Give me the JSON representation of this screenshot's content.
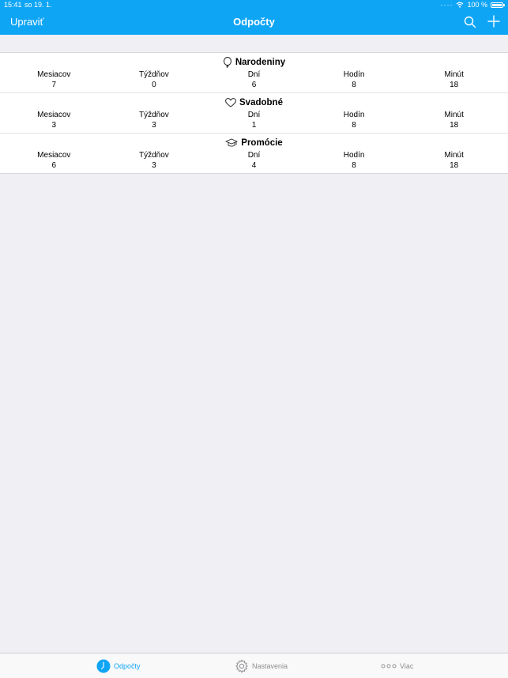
{
  "status_bar": {
    "time": "15:41",
    "date": "so 19. 1.",
    "battery": "100 %"
  },
  "nav": {
    "edit_label": "Upraviť",
    "title": "Odpočty"
  },
  "columns": [
    "Mesiacov",
    "Týždňov",
    "Dní",
    "Hodín",
    "Minút"
  ],
  "countdowns": [
    {
      "title": "Narodeniny",
      "icon": "balloon-icon",
      "values": [
        "7",
        "0",
        "6",
        "8",
        "18"
      ]
    },
    {
      "title": "Svadobné",
      "icon": "heart-icon",
      "values": [
        "3",
        "3",
        "1",
        "8",
        "18"
      ]
    },
    {
      "title": "Promócie",
      "icon": "graduation-cap-icon",
      "values": [
        "6",
        "3",
        "4",
        "8",
        "18"
      ]
    }
  ],
  "tabs": {
    "countdowns": "Odpočty",
    "settings": "Nastavenia",
    "more": "Viac"
  },
  "colors": {
    "accent": "#0fa5f5",
    "background": "#efeff4",
    "tab_inactive": "#8e8e93"
  }
}
